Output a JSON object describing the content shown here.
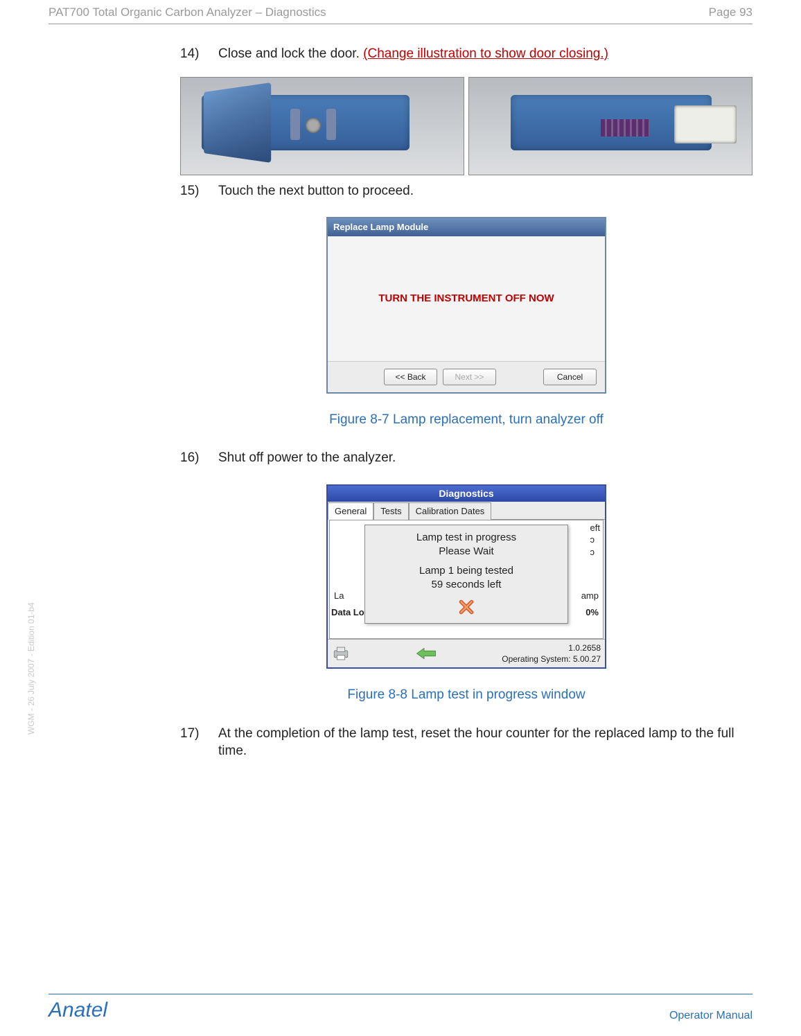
{
  "header": {
    "title": "PAT700 Total Organic Carbon Analyzer – Diagnostics",
    "page_label": "Page 93"
  },
  "steps": {
    "s14_num": "14)",
    "s14_text": "Close and lock the door. ",
    "s14_edit": "(Change illustration to show door closing.)",
    "s15_num": "15)",
    "s15_text": "Touch the next button to proceed.",
    "s16_num": "16)",
    "s16_text": "Shut off power to the analyzer.",
    "s17_num": "17)",
    "s17_text": "At the completion of the lamp test, reset the hour counter for the replaced lamp to the full time."
  },
  "dialog1": {
    "title": "Replace Lamp Module",
    "message": "TURN THE INSTRUMENT OFF NOW",
    "back": "<< Back",
    "next": "Next >>",
    "cancel": "Cancel"
  },
  "caption1": "Figure 8-7 Lamp replacement, turn analyzer off",
  "dialog2": {
    "title": "Diagnostics",
    "tabs": {
      "general": "General",
      "tests": "Tests",
      "cal": "Calibration Dates"
    },
    "frag_eft": "eft",
    "frag_br1": "ɔ",
    "frag_br2": "ɔ",
    "la": "La",
    "amp": "amp",
    "datal": "Data Lo",
    "zero": "0%",
    "popup_line1": "Lamp test in progress",
    "popup_line2": "Please Wait",
    "popup_line3": "Lamp 1 being tested",
    "popup_line4": "59  seconds left",
    "status_ver": "1.0.2658",
    "status_os": "Operating System: 5.00.27"
  },
  "caption2": "Figure 8-8 Lamp test in progress window",
  "footer": {
    "brand": "Anatel",
    "manual": "Operator Manual"
  },
  "side": "WGM - 26 July 2007 - Edition 01-b4"
}
